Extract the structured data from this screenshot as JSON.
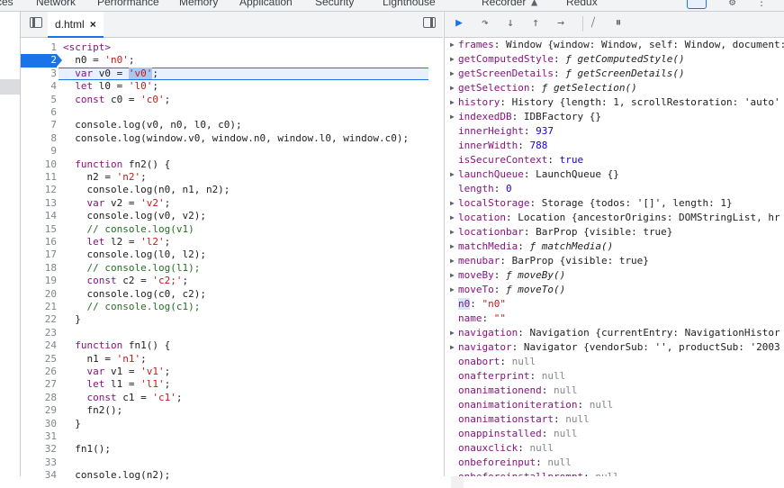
{
  "devtools_tabs": [
    "ces",
    "Network",
    "Performance",
    "Memory",
    "Application",
    "Security",
    "Lighthouse",
    "Recorder",
    "Redux"
  ],
  "file_tab": {
    "name": "d.html",
    "close": "×"
  },
  "code_lines": [
    {
      "n": "1",
      "t": "<script>"
    },
    {
      "n": "2",
      "t": "  n0 = 'n0';"
    },
    {
      "n": "3",
      "t": "  var v0 = 'v0';"
    },
    {
      "n": "4",
      "t": "  let l0 = 'l0';"
    },
    {
      "n": "5",
      "t": "  const c0 = 'c0';"
    },
    {
      "n": "6",
      "t": ""
    },
    {
      "n": "7",
      "t": "  console.log(v0, n0, l0, c0);"
    },
    {
      "n": "8",
      "t": "  console.log(window.v0, window.n0, window.l0, window.c0);"
    },
    {
      "n": "9",
      "t": ""
    },
    {
      "n": "10",
      "t": "  function fn2() {"
    },
    {
      "n": "11",
      "t": "    n2 = 'n2';"
    },
    {
      "n": "12",
      "t": "    console.log(n0, n1, n2);"
    },
    {
      "n": "13",
      "t": "    var v2 = 'v2';"
    },
    {
      "n": "14",
      "t": "    console.log(v0, v2);"
    },
    {
      "n": "15",
      "t": "    // console.log(v1)"
    },
    {
      "n": "16",
      "t": "    let l2 = 'l2';"
    },
    {
      "n": "17",
      "t": "    console.log(l0, l2);"
    },
    {
      "n": "18",
      "t": "    // console.log(l1);"
    },
    {
      "n": "19",
      "t": "    const c2 = 'c2;';"
    },
    {
      "n": "20",
      "t": "    console.log(c0, c2);"
    },
    {
      "n": "21",
      "t": "    // console.log(c1);"
    },
    {
      "n": "22",
      "t": "  }"
    },
    {
      "n": "23",
      "t": ""
    },
    {
      "n": "24",
      "t": "  function fn1() {"
    },
    {
      "n": "25",
      "t": "    n1 = 'n1';"
    },
    {
      "n": "26",
      "t": "    var v1 = 'v1';"
    },
    {
      "n": "27",
      "t": "    let l1 = 'l1';"
    },
    {
      "n": "28",
      "t": "    const c1 = 'c1';"
    },
    {
      "n": "29",
      "t": "    fn2();"
    },
    {
      "n": "30",
      "t": "  }"
    },
    {
      "n": "31",
      "t": ""
    },
    {
      "n": "32",
      "t": "  fn1();"
    },
    {
      "n": "33",
      "t": ""
    },
    {
      "n": "34",
      "t": "  console.log(n2);"
    }
  ],
  "breakpoint_line": "2",
  "paused_line": "3",
  "scope_props": [
    {
      "key": "frames",
      "val": "Window {window: Window, self: Window, document:",
      "exp": true,
      "vt": "v"
    },
    {
      "key": "getComputedStyle",
      "val": "ƒ getComputedStyle()",
      "exp": true,
      "vt": "vi"
    },
    {
      "key": "getScreenDetails",
      "val": "ƒ getScreenDetails()",
      "exp": true,
      "vt": "vi"
    },
    {
      "key": "getSelection",
      "val": "ƒ getSelection()",
      "exp": true,
      "vt": "vi"
    },
    {
      "key": "history",
      "val": "History {length: 1, scrollRestoration: 'auto'",
      "exp": true,
      "vt": "v"
    },
    {
      "key": "indexedDB",
      "val": "IDBFactory {}",
      "exp": true,
      "vt": "v"
    },
    {
      "key": "innerHeight",
      "val": "937",
      "exp": false,
      "vt": "vn"
    },
    {
      "key": "innerWidth",
      "val": "788",
      "exp": false,
      "vt": "vn"
    },
    {
      "key": "isSecureContext",
      "val": "true",
      "exp": false,
      "vt": "vn"
    },
    {
      "key": "launchQueue",
      "val": "LaunchQueue {}",
      "exp": true,
      "vt": "v"
    },
    {
      "key": "length",
      "val": "0",
      "exp": false,
      "vt": "vn"
    },
    {
      "key": "localStorage",
      "val": "Storage {todos: '[]', length: 1}",
      "exp": true,
      "vt": "v"
    },
    {
      "key": "location",
      "val": "Location {ancestorOrigins: DOMStringList, hr",
      "exp": true,
      "vt": "v"
    },
    {
      "key": "locationbar",
      "val": "BarProp {visible: true}",
      "exp": true,
      "vt": "v"
    },
    {
      "key": "matchMedia",
      "val": "ƒ matchMedia()",
      "exp": true,
      "vt": "vi"
    },
    {
      "key": "menubar",
      "val": "BarProp {visible: true}",
      "exp": true,
      "vt": "v"
    },
    {
      "key": "moveBy",
      "val": "ƒ moveBy()",
      "exp": true,
      "vt": "vi"
    },
    {
      "key": "moveTo",
      "val": "ƒ moveTo()",
      "exp": true,
      "vt": "vi"
    },
    {
      "key": "n0",
      "val": "\"n0\"",
      "exp": false,
      "vt": "vs",
      "sel": true
    },
    {
      "key": "name",
      "val": "\"\"",
      "exp": false,
      "vt": "vs"
    },
    {
      "key": "navigation",
      "val": "Navigation {currentEntry: NavigationHistor",
      "exp": true,
      "vt": "v"
    },
    {
      "key": "navigator",
      "val": "Navigator {vendorSub: '', productSub: '2003",
      "exp": true,
      "vt": "v"
    },
    {
      "key": "onabort",
      "val": "null",
      "exp": false,
      "vt": "vnull"
    },
    {
      "key": "onafterprint",
      "val": "null",
      "exp": false,
      "vt": "vnull"
    },
    {
      "key": "onanimationend",
      "val": "null",
      "exp": false,
      "vt": "vnull"
    },
    {
      "key": "onanimationiteration",
      "val": "null",
      "exp": false,
      "vt": "vnull"
    },
    {
      "key": "onanimationstart",
      "val": "null",
      "exp": false,
      "vt": "vnull"
    },
    {
      "key": "onappinstalled",
      "val": "null",
      "exp": false,
      "vt": "vnull"
    },
    {
      "key": "onauxclick",
      "val": "null",
      "exp": false,
      "vt": "vnull"
    },
    {
      "key": "onbeforeinput",
      "val": "null",
      "exp": false,
      "vt": "vnull"
    },
    {
      "key": "onbeforeinstallprompt",
      "val": "null",
      "exp": false,
      "vt": "vnull"
    }
  ],
  "colors": {
    "accent": "#1a73e8",
    "keyword": "#881280",
    "string": "#c41a16",
    "comment": "#236e25"
  }
}
